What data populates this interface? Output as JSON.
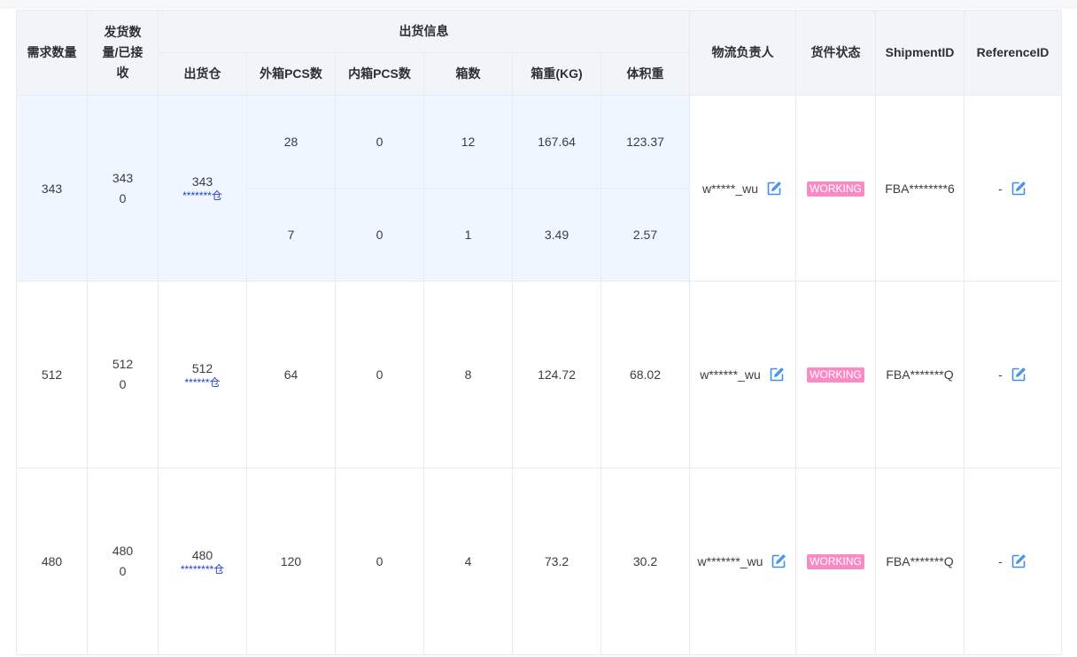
{
  "headers": {
    "demand_qty": "需求数量",
    "shipped_received": "发货数量/已接收",
    "ship_info": "出货信息",
    "warehouse": "出货仓",
    "outer_pcs": "外箱PCS数",
    "inner_pcs": "内箱PCS数",
    "box_count": "箱数",
    "box_weight": "箱重(KG)",
    "volume_weight": "体积重",
    "logistics_owner": "物流负责人",
    "cargo_status": "货件状态",
    "shipment_id": "ShipmentID",
    "reference_id": "ReferenceID"
  },
  "rows": [
    {
      "demand": "343",
      "shipped": "343",
      "received": "0",
      "warehouse_qty": "343",
      "warehouse_name": "*******仓",
      "boxes": [
        {
          "outer_pcs": "28",
          "inner_pcs": "0",
          "box_count": "12",
          "box_weight": "167.64",
          "volume_weight": "123.37"
        },
        {
          "outer_pcs": "7",
          "inner_pcs": "0",
          "box_count": "1",
          "box_weight": "3.49",
          "volume_weight": "2.57"
        }
      ],
      "owner": "w*****_wu",
      "status": "WORKING",
      "shipment_id": "FBA********6",
      "reference_id": "-"
    },
    {
      "demand": "512",
      "shipped": "512",
      "received": "0",
      "warehouse_qty": "512",
      "warehouse_name": "******仓",
      "boxes": [
        {
          "outer_pcs": "64",
          "inner_pcs": "0",
          "box_count": "8",
          "box_weight": "124.72",
          "volume_weight": "68.02"
        }
      ],
      "owner": "w******_wu",
      "status": "WORKING",
      "shipment_id": "FBA*******Q",
      "reference_id": "-"
    },
    {
      "demand": "480",
      "shipped": "480",
      "received": "0",
      "warehouse_qty": "480",
      "warehouse_name": "********仓",
      "boxes": [
        {
          "outer_pcs": "120",
          "inner_pcs": "0",
          "box_count": "4",
          "box_weight": "73.2",
          "volume_weight": "30.2"
        }
      ],
      "owner": "w*******_wu",
      "status": "WORKING",
      "shipment_id": "FBA*******Q",
      "reference_id": "-"
    }
  ],
  "icons": {
    "edit": "edit-icon"
  },
  "colors": {
    "header_bg": "#f1f4f8",
    "highlight_row_bg": "#f0f6ff",
    "status_badge": "#f98ac3",
    "edit_icon": "#3d8ef0",
    "warehouse_link": "#1a3fd0"
  }
}
